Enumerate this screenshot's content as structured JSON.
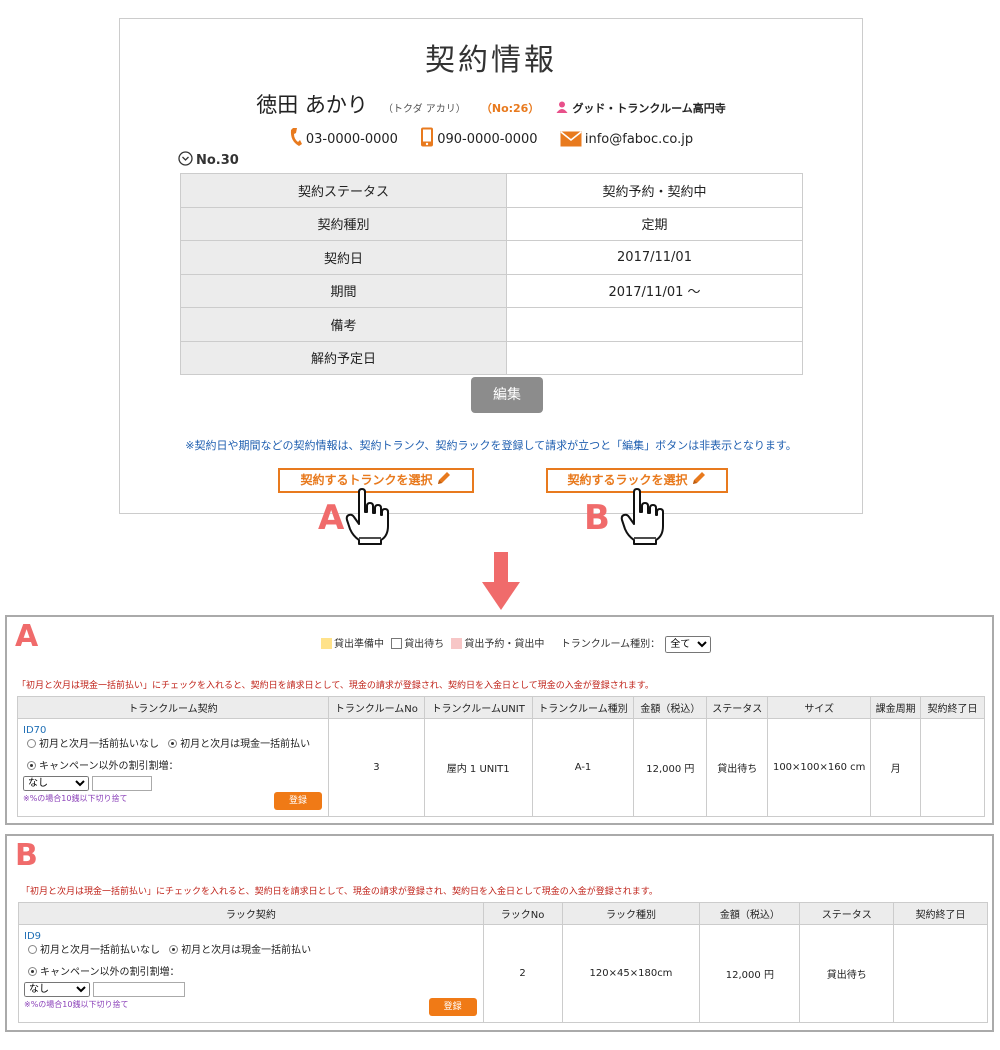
{
  "top": {
    "title": "契約情報",
    "customer_name": "徳田 あかり",
    "customer_kana": "（トクダ アカリ）",
    "customer_no": "（No:26）",
    "store": "グッド・トランクルーム高円寺",
    "phone": "03-0000-0000",
    "mobile": "090-0000-0000",
    "email": "info@faboc.co.jp",
    "contract_no": "No.30",
    "rows": [
      {
        "label": "契約ステータス",
        "value": "契約予約・契約中"
      },
      {
        "label": "契約種別",
        "value": "定期"
      },
      {
        "label": "契約日",
        "value": "2017/11/01"
      },
      {
        "label": "期間",
        "value": "2017/11/01 〜"
      },
      {
        "label": "備考",
        "value": ""
      },
      {
        "label": "解約予定日",
        "value": ""
      }
    ],
    "edit_label": "編集",
    "note": "※契約日や期間などの契約情報は、契約トランク、契約ラックを登録して請求が立つと「編集」ボタンは非表示となります。",
    "select_trunk_label": "契約するトランクを選択",
    "select_rack_label": "契約するラックを選択",
    "letter_a": "A",
    "letter_b": "B"
  },
  "colors": {
    "accent": "#e87a1e",
    "letter": "#f06b6b",
    "note_blue": "#1f5fb0",
    "red_note": "#c0241b",
    "legend_preparing": "#ffe28a",
    "legend_waiting": "#ffffff",
    "legend_reserved": "#f7c6c6"
  },
  "panel_a": {
    "letter": "A",
    "legend": {
      "preparing": "貸出準備中",
      "waiting": "貸出待ち",
      "reserved": "貸出予約・貸出中",
      "type_label": "トランクルーム種別：",
      "type_value": "全て"
    },
    "red_note": "「初月と次月は現金一括前払い」にチェックを入れると、契約日を請求日として、現金の請求が登録され、契約日を入金日として現金の入金が登録されます。",
    "headers": [
      "トランクルーム契約",
      "トランクルームNo",
      "トランクルームUNIT",
      "トランクルーム種別",
      "金額（税込）",
      "ステータス",
      "サイズ",
      "課金周期",
      "契約終了日"
    ],
    "row": {
      "id": "ID70",
      "radio_no": "初月と次月一括前払いなし",
      "radio_yes": "初月と次月は現金一括前払い",
      "campaign": "キャンペーン以外の割引割増：",
      "discount_value": "なし",
      "round_note": "※%の場合10銭以下切り捨て",
      "register_label": "登録",
      "no": "3",
      "unit": "屋内 1 UNIT1",
      "type": "A-1",
      "price": "12,000 円",
      "status": "貸出待ち",
      "size": "100×100×160 cm",
      "cycle": "月",
      "end_date": ""
    }
  },
  "panel_b": {
    "letter": "B",
    "red_note": "「初月と次月は現金一括前払い」にチェックを入れると、契約日を請求日として、現金の請求が登録され、契約日を入金日として現金の入金が登録されます。",
    "headers": [
      "ラック契約",
      "ラックNo",
      "ラック種別",
      "金額（税込）",
      "ステータス",
      "契約終了日"
    ],
    "row": {
      "id": "ID9",
      "radio_no": "初月と次月一括前払いなし",
      "radio_yes": "初月と次月は現金一括前払い",
      "campaign": "キャンペーン以外の割引割増：",
      "discount_value": "なし",
      "round_note": "※%の場合10銭以下切り捨て",
      "register_label": "登録",
      "no": "2",
      "type": "120×45×180cm",
      "price": "12,000 円",
      "status": "貸出待ち",
      "end_date": ""
    }
  }
}
